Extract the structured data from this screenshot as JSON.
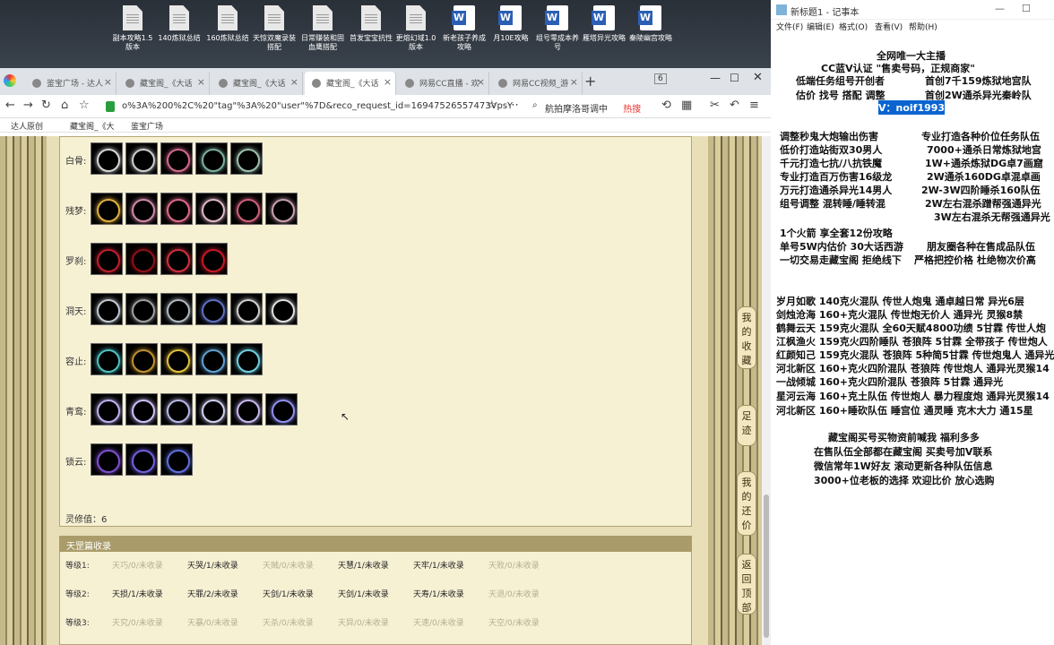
{
  "desktop": {
    "icons": [
      {
        "label": "副本攻略1.5版本",
        "type": "doc"
      },
      {
        "label": "140炼狱总结",
        "type": "doc"
      },
      {
        "label": "160炼狱总结",
        "type": "doc"
      },
      {
        "label": "天惊双魔录装搭配",
        "type": "doc"
      },
      {
        "label": "日常赚装和固血鹰搭配",
        "type": "doc"
      },
      {
        "label": "首发宝宝抗性",
        "type": "doc"
      },
      {
        "label": "更熔幻域1.0版本",
        "type": "doc"
      },
      {
        "label": "新老孩子养成攻略",
        "type": "word"
      },
      {
        "label": "月10E攻略",
        "type": "word"
      },
      {
        "label": "组号零成本养号",
        "type": "word"
      },
      {
        "label": "雁塔异光攻略",
        "type": "word"
      },
      {
        "label": "秦陵幽宫攻略",
        "type": "word"
      }
    ]
  },
  "browser": {
    "tabs": [
      "鉴宝广场 - 达人",
      "藏宝阁_《大话",
      "藏宝阁_《大话",
      "藏宝阁_《大话",
      "网易CC直播 - 欢",
      "网易CC视频_游"
    ],
    "tab_count": "6",
    "url": "o%3A%200%2C%20\"tag\"%3A%20\"user\"%7D&reco_request_id=16947526557473VpsY",
    "search_text": "航拍摩洛哥调中",
    "hot_label": "热搜",
    "bookmarks": [
      "达人原创",
      "藏宝阁_《大",
      "鉴宝广场"
    ]
  },
  "equip": {
    "rows": [
      {
        "label": "白骨:",
        "colors": [
          "#d8d8d8",
          "#cfcfcf",
          "#d46a8c",
          "#7bb0a0",
          "#9ec0b0"
        ]
      },
      {
        "label": "残梦:",
        "colors": [
          "#e0b040",
          "#d08aa8",
          "#e06a8a",
          "#e0b8c8",
          "#d0607a",
          "#c8a0b0"
        ]
      },
      {
        "label": "罗刹:",
        "colors": [
          "#c02030",
          "#901018",
          "#d03040",
          "#c81828"
        ]
      },
      {
        "label": "洞天:",
        "colors": [
          "#c0c8d0",
          "#a0a0a0",
          "#b0b8c0",
          "#6070c0",
          "#d0d0d0",
          "#e0e0e0"
        ]
      },
      {
        "label": "容止:",
        "colors": [
          "#50c0c0",
          "#c09030",
          "#e0c040",
          "#60a0d0",
          "#70d0e0"
        ]
      },
      {
        "label": "青鸾:",
        "colors": [
          "#c0b0f0",
          "#d0c0f8",
          "#b8b8e8",
          "#d0d0f0",
          "#c8b8f0",
          "#9090f0"
        ]
      },
      {
        "label": "锁云:",
        "colors": [
          "#8050d0",
          "#7060e0",
          "#6070e0"
        ]
      }
    ],
    "lingxiu": "灵修值：6"
  },
  "tianzhao": {
    "title": "天罡篇收录",
    "levels": [
      {
        "label": "等级1:",
        "items": [
          {
            "t": "天巧/0/未收录",
            "on": false
          },
          {
            "t": "天哭/1/未收录",
            "on": true
          },
          {
            "t": "天贼/0/未收录",
            "on": false
          },
          {
            "t": "天慧/1/未收录",
            "on": true
          },
          {
            "t": "天牢/1/未收录",
            "on": true
          },
          {
            "t": "天败/0/未收录",
            "on": false
          }
        ]
      },
      {
        "label": "等级2:",
        "items": [
          {
            "t": "天损/1/未收录",
            "on": true
          },
          {
            "t": "天罪/2/未收录",
            "on": true
          },
          {
            "t": "天剑/1/未收录",
            "on": true
          },
          {
            "t": "天剑/1/未收录",
            "on": true
          },
          {
            "t": "天寿/1/未收录",
            "on": true
          },
          {
            "t": "天退/0/未收录",
            "on": false
          }
        ]
      },
      {
        "label": "等级3:",
        "items": [
          {
            "t": "天究/0/未收录",
            "on": false
          },
          {
            "t": "天暴/0/未收录",
            "on": false
          },
          {
            "t": "天杀/0/未收录",
            "on": false
          },
          {
            "t": "天异/0/未收录",
            "on": false
          },
          {
            "t": "天速/0/未收录",
            "on": false
          },
          {
            "t": "天空/0/未收录",
            "on": false
          }
        ]
      }
    ]
  },
  "float_nav": [
    "我的收藏",
    "足迹",
    "我的还价",
    "返回顶部"
  ],
  "notepad": {
    "title": "新标题1 - 记事本",
    "menu": [
      "文件(F)",
      "编辑(E)",
      "格式(O)",
      "查看(V)",
      "帮助(H)"
    ],
    "lines": [
      "全网唯一大主播",
      "CC蓝V认证 \"售卖号码，正规商家\"",
      "低端任务组号开创者",
      "首创7千159炼狱地宫队",
      "估价 找号 搭配 调整",
      "首创2W通杀异光秦岭队",
      "V：noif1993",
      "调整秒鬼大炮输出伤害",
      "专业打造各种价位任务队伍",
      "低价打造站街双30男人",
      "7000+通杀日常炼狱地宫",
      "千元打造七抗/八抗铁魔",
      "1W+通杀炼狱DG卓7画窟",
      "专业打造百万伤害16级龙",
      "2W通杀160DG卓混卓画",
      "万元打造通杀异光14男人",
      "2W-3W四阶睡杀160队伍",
      "组号调整 混转睡/睡转混",
      "2W左右混杀蹭帮强通异光",
      "3W左右混杀无帮强通异光",
      "1个火箭 享全套12份攻略",
      "单号5W内估价 30大话西游",
      "朋友圈各种在售成品队伍",
      "一切交易走藏宝阁 拒绝线下",
      "严格把控价格 杜绝物次价高",
      "岁月如歌 140克火混队 传世人炮鬼 通卓越日常 异光6层",
      "剑烛沧海 160+克火混队 传世炮无价人 通异光 灵猴8禁",
      "鹤舞云天 159克火混队 全60天赋4800功绩 5甘霖 传世人炮",
      "江枫渔火 159克火四阶睡队 苍狼阵 5甘霖 全带孩子 传世炮人",
      "红颜知己 159克火混队 苍狼阵 5种简5甘霖 传世炮鬼人 通异光",
      "河北新区 160+克火四阶混队 苍狼阵 传世炮人 通异光灵猴14",
      "一战倾城 160+克火四阶混队 苍狼阵 5甘霖 通异光",
      "星河云海 160+克土队伍 传世炮人 暴力程度炮 通异光灵猴14",
      "河北新区 160+睡砍队伍 睡宫位 通灵睡 克木大力 通15星",
      "藏宝阁买号买物资前喊我 福利多多",
      "在售队伍全部都在藏宝阁 买卖号加V联系",
      "微信常年1W好友 滚动更新各种队伍信息",
      "3000+位老板的选择 欢迎比价 放心选购"
    ]
  },
  "colors": {
    "highlight": "#0a64d0",
    "parchment": "#f7f1d4",
    "section_header": "#aa9c6a"
  }
}
